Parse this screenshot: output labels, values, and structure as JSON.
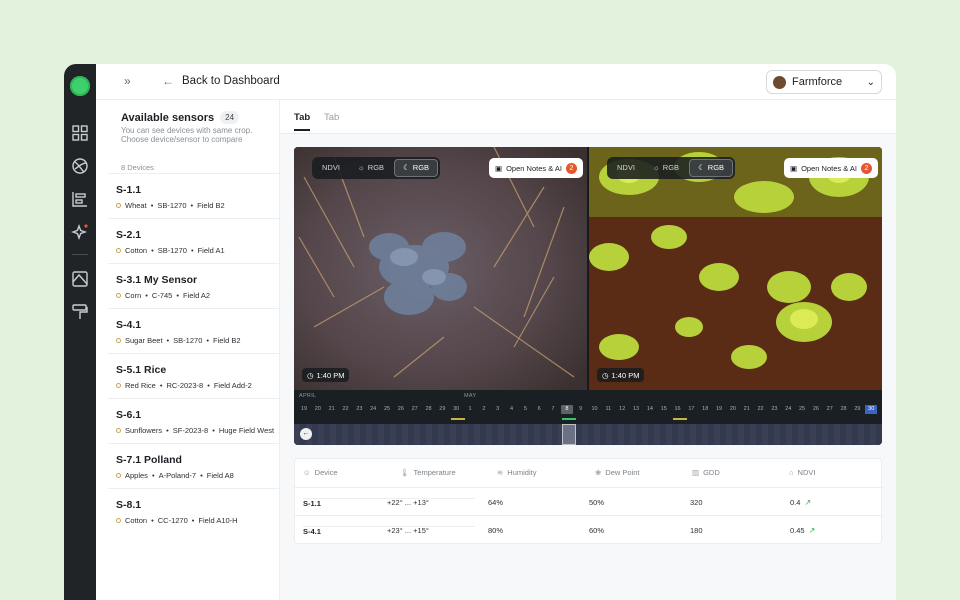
{
  "nav": {
    "collapse_icon": "»",
    "back_label": "Back to Dashboard",
    "org_name": "Farmforce"
  },
  "sidebar": {
    "title": "Available sensors",
    "count": "24",
    "description": "You can see devices with same crop. Choose device/sensor to compare",
    "device_count": "8 Devices",
    "devices": [
      {
        "name": "S-1.1",
        "crop": "Wheat",
        "code": "SB-1270",
        "field": "Field B2"
      },
      {
        "name": "S-2.1",
        "crop": "Cotton",
        "code": "SB-1270",
        "field": "Field A1"
      },
      {
        "name": "S-3.1 My Sensor",
        "crop": "Corn",
        "code": "C-745",
        "field": "Field A2"
      },
      {
        "name": "S-4.1",
        "crop": "Sugar Beet",
        "code": "SB-1270",
        "field": "Field B2"
      },
      {
        "name": "S-5.1 Rice",
        "crop": "Red Rice",
        "code": "RC-2023-8",
        "field": "Field Add-2"
      },
      {
        "name": "S-6.1",
        "crop": "Sunflowers",
        "code": "SF-2023-8",
        "field": "Huge Field West"
      },
      {
        "name": "S-7.1 Polland",
        "crop": "Apples",
        "code": "A-Poland-7",
        "field": "Field A8"
      },
      {
        "name": "S-8.1",
        "crop": "Cotton",
        "code": "CC-1270",
        "field": "Field A10-H"
      }
    ]
  },
  "tabs": [
    "Tab",
    "Tab"
  ],
  "viewer": {
    "modes": [
      "NDVI",
      "RGB",
      "RGB"
    ],
    "notes_label": "Open Notes & AI",
    "notes_count": "2",
    "time_left": "1:40 PM",
    "time_right": "1:40 PM",
    "months": [
      "APRIL",
      "MAY"
    ],
    "days": [
      "19",
      "20",
      "21",
      "22",
      "23",
      "24",
      "25",
      "26",
      "27",
      "28",
      "29",
      "30",
      "1",
      "2",
      "3",
      "4",
      "5",
      "6",
      "7",
      "8",
      "9",
      "10",
      "11",
      "12",
      "13",
      "14",
      "15",
      "16",
      "17",
      "18",
      "19",
      "20",
      "21",
      "22",
      "23",
      "24",
      "25",
      "26",
      "27",
      "28",
      "29",
      "30"
    ]
  },
  "table": {
    "headers": [
      "Device",
      "Temperature",
      "Humidity",
      "Dew Point",
      "GDD",
      "NDVI"
    ],
    "rows": [
      {
        "device": "S-1.1",
        "temperature": "+22° ... +13°",
        "humidity": "64%",
        "dew_point": "50%",
        "gdd": "320",
        "ndvi": "0.4"
      },
      {
        "device": "S-4.1",
        "temperature": "+23° ... +15°",
        "humidity": "80%",
        "dew_point": "60%",
        "gdd": "180",
        "ndvi": "0.45"
      }
    ]
  },
  "colors": {
    "background": "#e3f2dd",
    "rail": "#202427",
    "accent_green": "#3ed06b",
    "badge": "#e4572e",
    "selected_day": "#3b63c4"
  },
  "icons": {
    "rail": [
      "logo",
      "grid-icon",
      "globe-icon",
      "chart-bars-icon",
      "sparkle-icon",
      "map-icon",
      "roller-icon"
    ],
    "table": [
      "user-icon",
      "thermometer-icon",
      "humidity-icon",
      "dew-icon",
      "chart-icon",
      "leaf-icon"
    ]
  }
}
